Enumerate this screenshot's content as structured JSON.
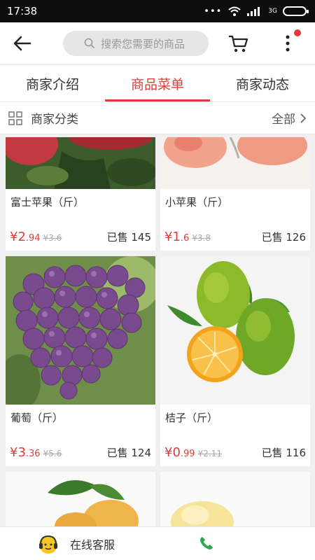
{
  "status": {
    "time": "17:38",
    "signal": "3G"
  },
  "search": {
    "placeholder": "搜索您需要的商品"
  },
  "tabs": [
    "商家介绍",
    "商品菜单",
    "商家动态"
  ],
  "category": {
    "label": "商家分类",
    "all": "全部"
  },
  "products": [
    {
      "name": "富士苹果（斤）",
      "price_int": "2",
      "price_dec": ".94",
      "orig": "¥3.6",
      "sold": "已售 145"
    },
    {
      "name": "小苹果（斤）",
      "price_int": "1",
      "price_dec": ".6",
      "orig": "¥3.8",
      "sold": "已售 126"
    },
    {
      "name": "葡萄（斤）",
      "price_int": "3",
      "price_dec": ".36",
      "orig": "¥5.6",
      "sold": "已售 124"
    },
    {
      "name": "桔子（斤）",
      "price_int": "0",
      "price_dec": ".99",
      "orig": "¥2.11",
      "sold": "已售 116"
    }
  ],
  "currency": "¥",
  "bottom": {
    "service": "在线客服"
  },
  "colors": {
    "accent": "#e23b3b"
  }
}
